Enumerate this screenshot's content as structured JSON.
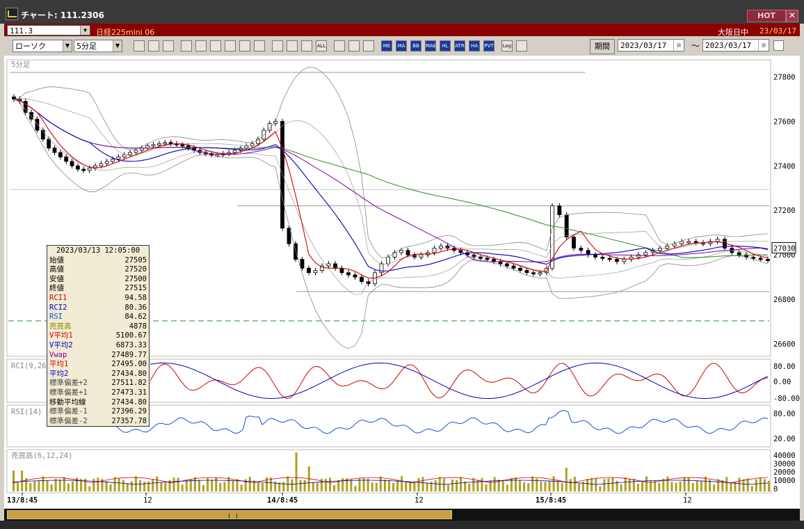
{
  "window": {
    "title": "チャート: 111.2306",
    "hot_label": "HOT",
    "close_label": "✕"
  },
  "instrument": {
    "code": "111.3",
    "name": "日経225mini 06",
    "session": "大阪日中",
    "date": "23/03/17"
  },
  "toolbar": {
    "chart_type": "ローソク",
    "timeframe": "5分足",
    "period_label": "期間",
    "from_date": "2023/03/17",
    "to_date": "2023/03/17",
    "tilde": "〜",
    "buttons": [
      "search",
      "cross",
      "arrow-down",
      "zoom",
      "rect",
      "compare",
      "pie",
      "line",
      "pointer",
      "arrow",
      "candle",
      "bar",
      "ALL",
      "gear",
      "pencil",
      "palette",
      "ME",
      "MA",
      "BB",
      "MAE",
      "HL",
      "ATR",
      "HA",
      "PVT",
      "Log",
      "exit"
    ]
  },
  "chart_data": [
    {
      "type": "candlestick",
      "panel": "price",
      "title": "5分足",
      "ylim": [
        26550,
        27870
      ],
      "yticks": [
        "27800",
        "27600",
        "27400",
        "27200",
        "27000",
        "26800",
        "26600"
      ],
      "current_value": "27030",
      "xticks": [
        "13/8:45",
        "12",
        "14/8:45",
        "12",
        "15/8:45",
        "12"
      ],
      "ohlc_sample": {
        "timestamp": "2023/03/13 12:05:00",
        "open": 27505,
        "high": 27520,
        "low": 27500,
        "close": 27515
      },
      "close_series": [
        27700,
        27690,
        27640,
        27610,
        27560,
        27520,
        27480,
        27460,
        27440,
        27420,
        27400,
        27385,
        27380,
        27390,
        27400,
        27410,
        27420,
        27430,
        27440,
        27450,
        27460,
        27470,
        27480,
        27490,
        27495,
        27500,
        27505,
        27500,
        27495,
        27490,
        27480,
        27470,
        27460,
        27455,
        27450,
        27450,
        27455,
        27460,
        27470,
        27480,
        27490,
        27500,
        27520,
        27560,
        27590,
        27600,
        27120,
        27050,
        26980,
        26940,
        26920,
        26930,
        26950,
        26960,
        26940,
        26920,
        26910,
        26900,
        26880,
        26870,
        26920,
        26960,
        26990,
        27010,
        27020,
        27000,
        26990,
        27000,
        27010,
        27030,
        27040,
        27030,
        27020,
        27010,
        27000,
        26990,
        26985,
        26980,
        26970,
        26960,
        26950,
        26940,
        26930,
        26920,
        26915,
        26920,
        26940,
        27220,
        27180,
        27080,
        27030,
        27020,
        27000,
        26990,
        26985,
        26980,
        26970,
        26980,
        26990,
        27000,
        27010,
        27020,
        27030,
        27040,
        27050,
        27060,
        27060,
        27055,
        27050,
        27060,
        27070,
        27030,
        27010,
        27000,
        26990,
        26985,
        26980,
        26975
      ]
    },
    {
      "type": "line",
      "panel": "RCI",
      "title": "RCI(9,26)",
      "yticks": [
        "80.00",
        "0.00",
        "-80.00"
      ],
      "series": [
        {
          "name": "RCI1",
          "color": "#d00000"
        },
        {
          "name": "RCI2",
          "color": "#0000c0"
        }
      ]
    },
    {
      "type": "line",
      "panel": "RSI",
      "title": "RSI(14)",
      "yticks": [
        "80.00",
        "20.00"
      ],
      "series": [
        {
          "name": "RSI",
          "color": "#1050e0"
        }
      ]
    },
    {
      "type": "bar",
      "panel": "volume",
      "title": "売買高(6,12,24)",
      "yticks": [
        "40000",
        "30000",
        "20000",
        "10000",
        "0"
      ]
    }
  ],
  "info_box": {
    "datetime": "2023/03/13  12:05:00",
    "rows": [
      {
        "label": "始値",
        "value": "27505",
        "color": "#000000"
      },
      {
        "label": "高値",
        "value": "27520",
        "color": "#000000"
      },
      {
        "label": "安値",
        "value": "27500",
        "color": "#000000"
      },
      {
        "label": "終値",
        "value": "27515",
        "color": "#000000"
      },
      {
        "label": "RCI1",
        "value": "94.58",
        "color": "#d00000"
      },
      {
        "label": "RCI2",
        "value": "80.36",
        "color": "#0000c0"
      },
      {
        "label": "RSI",
        "value": "84.62",
        "color": "#1050e0"
      },
      {
        "label": "売買高",
        "value": "4878",
        "color": "#8a8a00"
      },
      {
        "label": "V平均1",
        "value": "5100.67",
        "color": "#d00000"
      },
      {
        "label": "V平均2",
        "value": "6873.33",
        "color": "#0000c0"
      },
      {
        "label": "Vwap",
        "value": "27489.77",
        "color": "#8000a0"
      },
      {
        "label": "平均1",
        "value": "27495.00",
        "color": "#d00000"
      },
      {
        "label": "平均2",
        "value": "27434.80",
        "color": "#0000c0"
      },
      {
        "label": "標準偏差+2",
        "value": "27511.82",
        "color": "#444444"
      },
      {
        "label": "標準偏差+1",
        "value": "27473.31",
        "color": "#444444"
      },
      {
        "label": "移動平均線",
        "value": "27434.80",
        "color": "#000000"
      },
      {
        "label": "標準偏差-1",
        "value": "27396.29",
        "color": "#444444"
      },
      {
        "label": "標準偏差-2",
        "value": "27357.78",
        "color": "#444444"
      }
    ]
  }
}
